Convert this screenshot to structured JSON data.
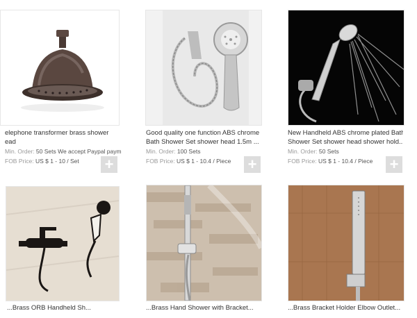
{
  "products": [
    {
      "title_line1": "elephone transformer brass shower",
      "title_line2": "ead",
      "min_order_label": "Min. Order:",
      "min_order_value": "50 Sets We accept Paypal paym...",
      "fob_label": "FOB Price:",
      "fob_value": "US $ 1 - 10 / Set"
    },
    {
      "title_line1": "Good quality one function ABS chrome",
      "title_line2": "Bath Shower Set shower head 1.5m ...",
      "min_order_label": "Min. Order:",
      "min_order_value": "100 Sets",
      "fob_label": "FOB Price:",
      "fob_value": "US $ 1 - 10.4 / Piece"
    },
    {
      "title_line1": "New Handheld ABS chrome plated Bath",
      "title_line2": "Shower Set shower head shower hold...",
      "min_order_label": "Min. Order:",
      "min_order_value": "50 Sets",
      "fob_label": "FOB Price:",
      "fob_value": "US $ 1 - 10.4 / Piece"
    },
    {
      "title_line1": "...Brass ORB Handheld Sh..."
    },
    {
      "title_line1": "...Brass Hand Shower with Bracket..."
    },
    {
      "title_line1": "...Brass Bracket Holder Elbow Outlet..."
    }
  ],
  "plus_glyph": "+",
  "colors": {
    "plus_bg": "#dddddd",
    "bronze": "#5a4740",
    "chrome": "#c9c9c9"
  }
}
